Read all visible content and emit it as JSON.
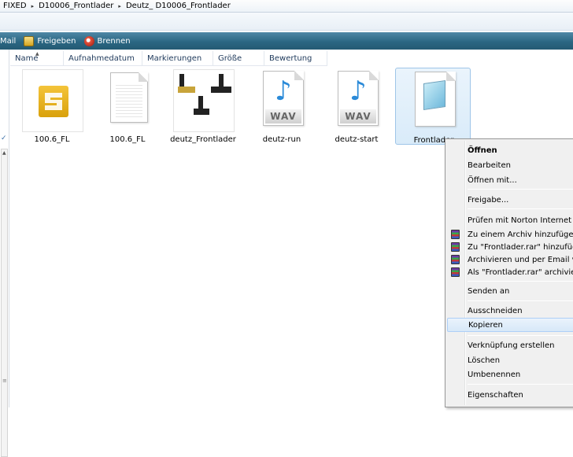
{
  "address": {
    "segments": [
      "FIXED",
      "D10006_Frontlader",
      "Deutz_ D10006_Frontlader"
    ],
    "separator": "▸"
  },
  "toolbar": {
    "mail_label": "Mail",
    "share_label": "Freigeben",
    "burn_label": "Brennen"
  },
  "columns": [
    "Name",
    "Aufnahmedatum",
    "Markierungen",
    "Größe",
    "Bewertung"
  ],
  "files": [
    {
      "name": "100.6_FL",
      "icon": "application-icon"
    },
    {
      "name": "100.6_FL",
      "icon": "document-icon"
    },
    {
      "name": "deutz_Frontlader",
      "icon": "image-icon"
    },
    {
      "name": "deutz-run",
      "icon": "wav-audio-icon",
      "badge": "WAV"
    },
    {
      "name": "deutz-start",
      "icon": "wav-audio-icon",
      "badge": "WAV"
    },
    {
      "name": "Frontlader",
      "icon": "notepad-icon",
      "selected": true
    }
  ],
  "context_menu": {
    "open": "Öffnen",
    "edit": "Bearbeiten",
    "open_with": "Öffnen mit...",
    "share": "Freigabe...",
    "norton": "Prüfen mit Norton Internet Security",
    "add_archive": "Zu einem Archiv hinzufügen...",
    "add_rar": "Zu \"Frontlader.rar\" hinzufügen",
    "archive_email": "Archivieren und per Email versenden...",
    "archive_rar_email": "Als \"Frontlader.rar\" archivieren und per Email versenden",
    "send_to": "Senden an",
    "cut": "Ausschneiden",
    "copy": "Kopieren",
    "create_shortcut": "Verknüpfung erstellen",
    "delete": "Löschen",
    "rename": "Umbenennen",
    "properties": "Eigenschaften",
    "highlighted": "Kopieren"
  },
  "colors": {
    "toolbar": "#2b6783",
    "selection": "#d9ebf9",
    "wav_note": "#2a8ad8",
    "app_logo": "#f4c43a"
  }
}
